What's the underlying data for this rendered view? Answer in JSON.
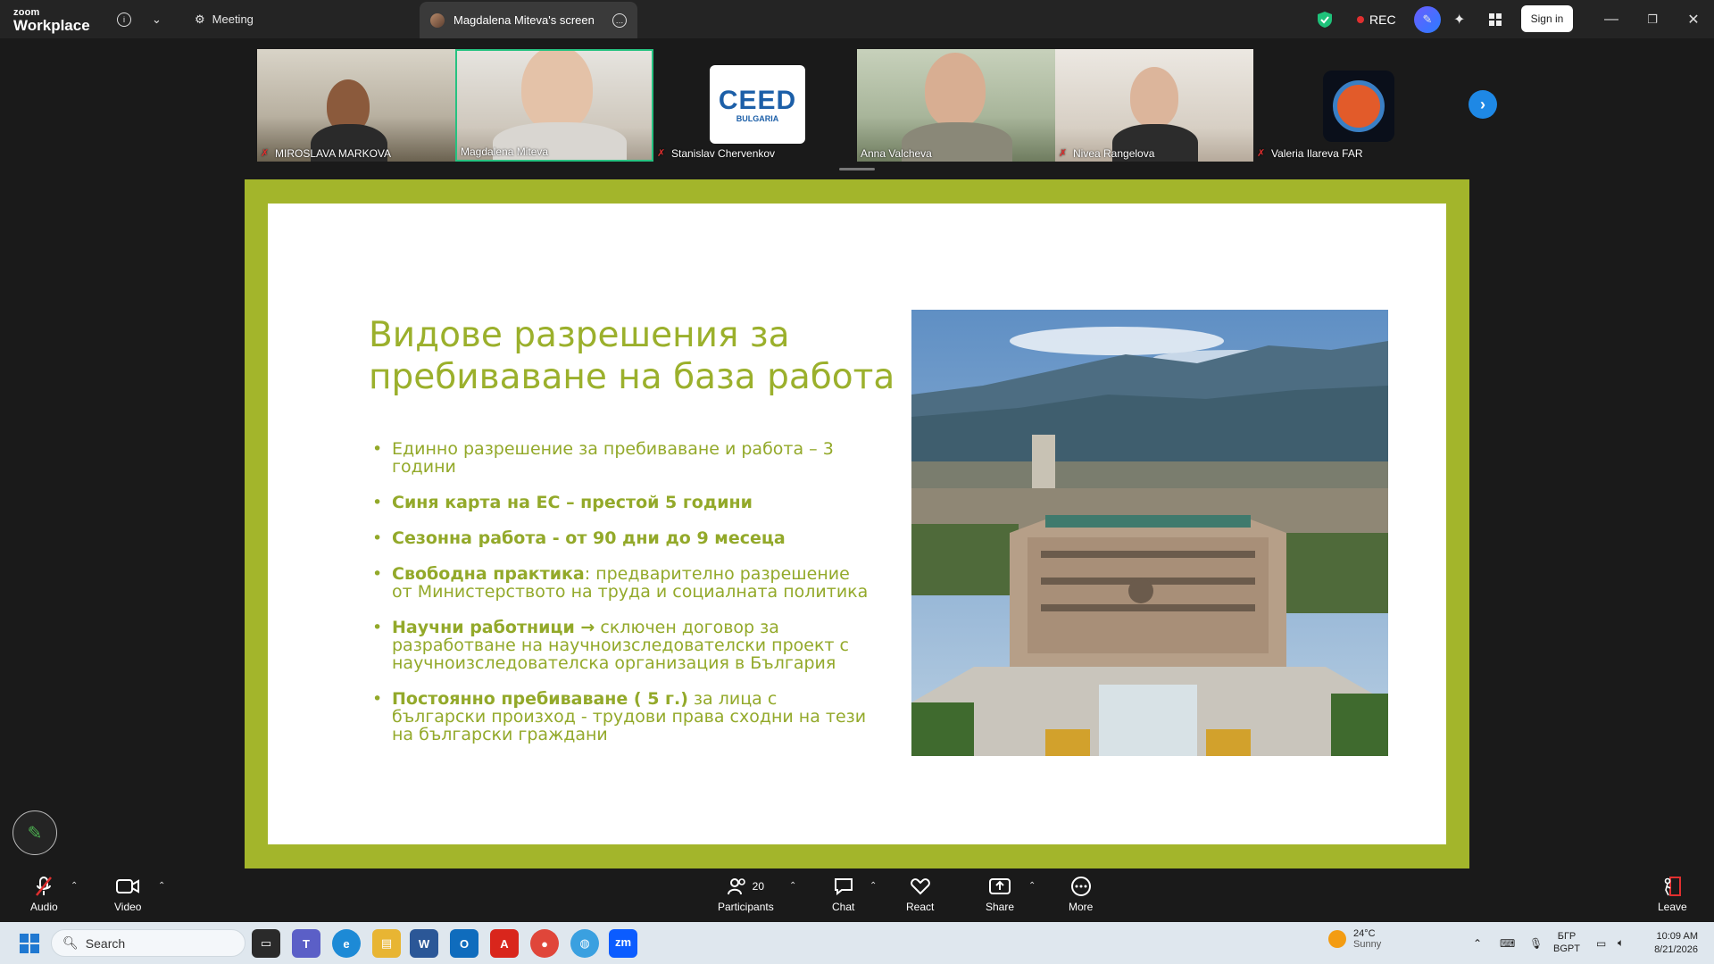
{
  "titlebar": {
    "brand_small": "zoom",
    "brand_big": "Workplace",
    "meeting_label": "Meeting",
    "active_tab": "Magdalena Miteva's screen",
    "rec_label": "REC",
    "signin_label": "Sign in"
  },
  "gallery": {
    "participants": [
      {
        "name": "MIROSLAVA MARKOVA",
        "muted": true
      },
      {
        "name": "Magdalena Miteva",
        "muted": false,
        "active_speaker": true
      },
      {
        "name": "Stanislav Chervenkov",
        "muted": true
      },
      {
        "name": "Anna Valcheva",
        "muted": false
      },
      {
        "name": "Nivea Rangelova",
        "muted": true
      },
      {
        "name": "Valeria Ilareva FAR",
        "muted": true
      }
    ],
    "ceed_logo": {
      "main": "CEED",
      "sub": "BULGARIA"
    }
  },
  "slide": {
    "title": "Видове разрешения за пребиваване на база работа",
    "bullets": [
      {
        "bold": "",
        "text": "Единно разрешение за пребиваване и работа – 3 години"
      },
      {
        "bold": "Синя карта на ЕС – престой 5 години",
        "text": ""
      },
      {
        "bold": "Сезонна работа  - от 90 дни до 9 месеца",
        "text": ""
      },
      {
        "bold": "Свободна практика",
        "text": ": предварително разрешение от Министерството на труда и социалната политика"
      },
      {
        "bold": "Научни работници →",
        "text": " сключен договор за разработване на научноизследователски проект с научноизследователска организация в България"
      },
      {
        "bold": "Постоянно пребиваване ( 5 г.)",
        "text": " за лица с български произход -  трудови права сходни на тези на български граждани"
      }
    ]
  },
  "toolbar": {
    "audio": "Audio",
    "video": "Video",
    "participants": "Participants",
    "participant_count": "20",
    "chat": "Chat",
    "react": "React",
    "share": "Share",
    "more": "More",
    "leave": "Leave"
  },
  "taskbar": {
    "search_placeholder": "Search",
    "weather_temp": "24°C",
    "weather_desc": "Sunny",
    "lang_top": "БГР",
    "lang_bottom": "BGPT",
    "time": "10:09 AM",
    "date": "8/21/2026"
  },
  "colors": {
    "slide_accent": "#a3b52b",
    "slide_text": "#93a92a",
    "active_speaker_border": "#26c281",
    "rec_dot": "#e02f2f",
    "zoom_blue": "#1e88e5"
  }
}
